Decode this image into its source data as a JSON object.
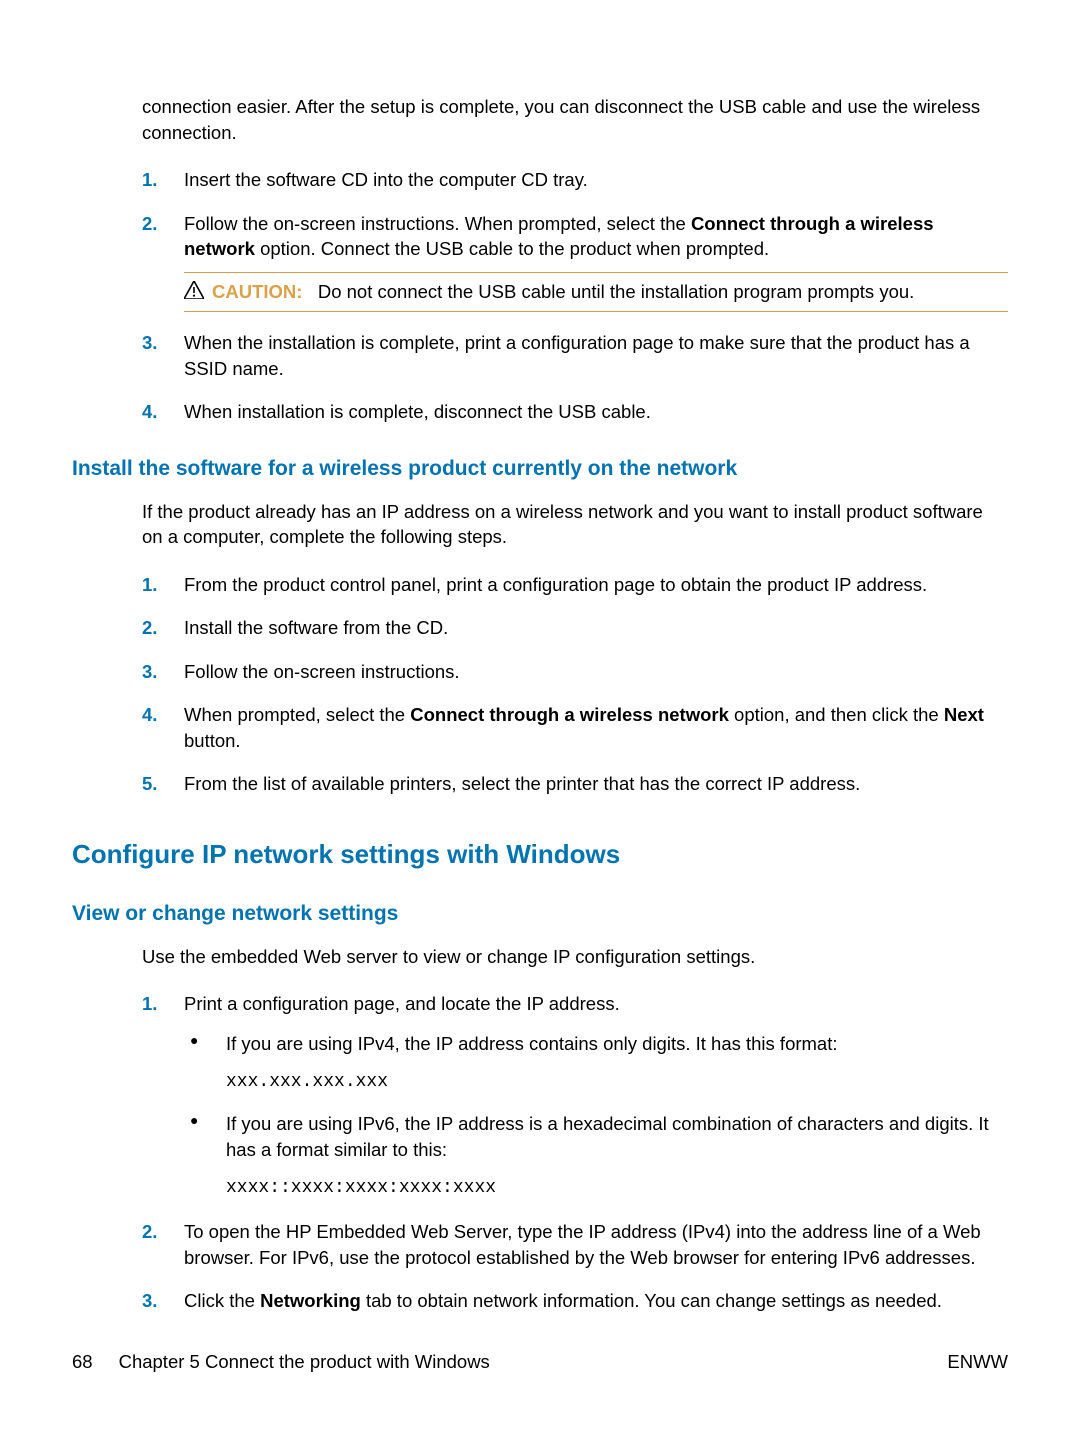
{
  "intro_para": "connection easier. After the setup is complete, you can disconnect the USB cable and use the wireless connection.",
  "list1": {
    "items": [
      {
        "num": "1.",
        "text_before": "Insert the software CD into the computer CD tray."
      },
      {
        "num": "2.",
        "text_before": "Follow the on-screen instructions. When prompted, select the ",
        "bold1": "Connect through a wireless network",
        "text_mid": " option. Connect the USB cable to the product when prompted."
      },
      {
        "num": "3.",
        "text_before": "When the installation is complete, print a configuration page to make sure that the product has a SSID name."
      },
      {
        "num": "4.",
        "text_before": "When installation is complete, disconnect the USB cable."
      }
    ]
  },
  "caution": {
    "label": "CAUTION:",
    "text": "Do not connect the USB cable until the installation program prompts you."
  },
  "section2": {
    "heading": "Install the software for a wireless product currently on the network",
    "intro": "If the product already has an IP address on a wireless network and you want to install product software on a computer, complete the following steps.",
    "items": [
      {
        "num": "1.",
        "text_before": "From the product control panel, print a configuration page to obtain the product IP address."
      },
      {
        "num": "2.",
        "text_before": "Install the software from the CD."
      },
      {
        "num": "3.",
        "text_before": "Follow the on-screen instructions."
      },
      {
        "num": "4.",
        "text_before": "When prompted, select the ",
        "bold1": "Connect through a wireless network",
        "text_mid": " option, and then click the ",
        "bold2": "Next",
        "text_after": " button."
      },
      {
        "num": "5.",
        "text_before": "From the list of available printers, select the printer that has the correct IP address."
      }
    ]
  },
  "section3": {
    "heading": "Configure IP network settings with Windows"
  },
  "section4": {
    "heading": "View or change network settings",
    "intro": "Use the embedded Web server to view or change IP configuration settings.",
    "items": {
      "item1": {
        "num": "1.",
        "text": "Print a configuration page, and locate the IP address.",
        "bullets": [
          {
            "text": "If you are using IPv4, the IP address contains only digits. It has this format:",
            "code": "xxx.xxx.xxx.xxx"
          },
          {
            "text": "If you are using IPv6, the IP address is a hexadecimal combination of characters and digits. It has a format similar to this:",
            "code": "xxxx::xxxx:xxxx:xxxx:xxxx"
          }
        ]
      },
      "item2": {
        "num": "2.",
        "text": "To open the HP Embedded Web Server, type the IP address (IPv4) into the address line of a Web browser. For IPv6, use the protocol established by the Web browser for entering IPv6 addresses."
      },
      "item3": {
        "num": "3.",
        "text_before": "Click the ",
        "bold1": "Networking",
        "text_after": " tab to obtain network information. You can change settings as needed."
      }
    }
  },
  "footer": {
    "page_num": "68",
    "chapter": "Chapter 5   Connect the product with Windows",
    "right": "ENWW"
  }
}
